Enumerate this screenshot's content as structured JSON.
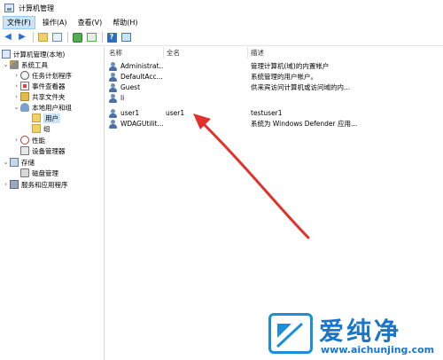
{
  "window": {
    "title": "计算机管理"
  },
  "menu": [
    "文件(F)",
    "操作(A)",
    "查看(V)",
    "帮助(H)"
  ],
  "tree": {
    "root": "计算机管理(本地)",
    "system_tools": "系统工具",
    "task_scheduler": "任务计划程序",
    "event_viewer": "事件查看器",
    "shared_folders": "共享文件夹",
    "local_users_groups": "本地用户和组",
    "users": "用户",
    "groups": "组",
    "performance": "性能",
    "device_manager": "设备管理器",
    "storage": "存储",
    "disk_management": "磁盘管理",
    "services_apps": "服务和应用程序"
  },
  "columns": {
    "name": "名称",
    "fullname": "全名",
    "desc": "描述"
  },
  "users": [
    {
      "name": "Administrat...",
      "fullname": "",
      "desc": "管理计算机(域)的内置帐户"
    },
    {
      "name": "DefaultAcc...",
      "fullname": "",
      "desc": "系统管理的用户帐户。"
    },
    {
      "name": "Guest",
      "fullname": "",
      "desc": "供来宾访问计算机或访问域的内..."
    },
    {
      "name": "li",
      "fullname": "",
      "desc": ""
    },
    {
      "name": "user1",
      "fullname": "user1",
      "desc": "testuser1"
    },
    {
      "name": "WDAGUtilit...",
      "fullname": "",
      "desc": "系统为 Windows Defender 应用..."
    }
  ],
  "watermark": {
    "title": "爱纯净",
    "url": "www.aichunjing.com"
  },
  "colors": {
    "arrow": "#e0322b",
    "selection": "#cce4f7",
    "brand": "#1976c8"
  }
}
